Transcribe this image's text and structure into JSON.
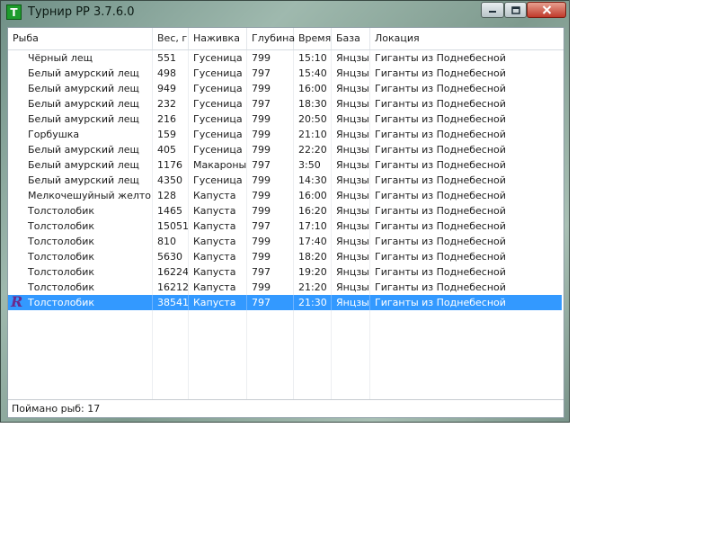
{
  "window": {
    "title": "Турнир РР 3.7.6.0",
    "app_icon_letter": "T"
  },
  "columns": [
    "Рыба",
    "Вес, г",
    "Наживка",
    "Глубина",
    "Время",
    "База",
    "Локация"
  ],
  "rows": [
    {
      "fish": "Чёрный лещ",
      "weight": "551",
      "bait": "Гусеница",
      "depth": "799",
      "time": "15:10",
      "base": "Янцзы",
      "location": "Гиганты из Поднебесной"
    },
    {
      "fish": "Белый амурский лещ",
      "weight": "498",
      "bait": "Гусеница",
      "depth": "797",
      "time": "15:40",
      "base": "Янцзы",
      "location": "Гиганты из Поднебесной"
    },
    {
      "fish": "Белый амурский лещ",
      "weight": "949",
      "bait": "Гусеница",
      "depth": "799",
      "time": "16:00",
      "base": "Янцзы",
      "location": "Гиганты из Поднебесной"
    },
    {
      "fish": "Белый амурский лещ",
      "weight": "232",
      "bait": "Гусеница",
      "depth": "797",
      "time": "18:30",
      "base": "Янцзы",
      "location": "Гиганты из Поднебесной"
    },
    {
      "fish": "Белый амурский лещ",
      "weight": "216",
      "bait": "Гусеница",
      "depth": "799",
      "time": "20:50",
      "base": "Янцзы",
      "location": "Гиганты из Поднебесной"
    },
    {
      "fish": "Горбушка",
      "weight": "159",
      "bait": "Гусеница",
      "depth": "799",
      "time": "21:10",
      "base": "Янцзы",
      "location": "Гиганты из Поднебесной"
    },
    {
      "fish": "Белый амурский лещ",
      "weight": "405",
      "bait": "Гусеница",
      "depth": "799",
      "time": "22:20",
      "base": "Янцзы",
      "location": "Гиганты из Поднебесной"
    },
    {
      "fish": "Белый амурский лещ",
      "weight": "1176",
      "bait": "Макароны",
      "depth": "797",
      "time": "3:50",
      "base": "Янцзы",
      "location": "Гиганты из Поднебесной"
    },
    {
      "fish": "Белый амурский лещ",
      "weight": "4350",
      "bait": "Гусеница",
      "depth": "799",
      "time": "14:30",
      "base": "Янцзы",
      "location": "Гиганты из Поднебесной"
    },
    {
      "fish": "Мелкочешуйный желтопёр",
      "weight": "128",
      "bait": "Капуста",
      "depth": "799",
      "time": "16:00",
      "base": "Янцзы",
      "location": "Гиганты из Поднебесной"
    },
    {
      "fish": "Толстолобик",
      "weight": "1465",
      "bait": "Капуста",
      "depth": "799",
      "time": "16:20",
      "base": "Янцзы",
      "location": "Гиганты из Поднебесной"
    },
    {
      "fish": "Толстолобик",
      "weight": "15051",
      "bait": "Капуста",
      "depth": "797",
      "time": "17:10",
      "base": "Янцзы",
      "location": "Гиганты из Поднебесной"
    },
    {
      "fish": "Толстолобик",
      "weight": "810",
      "bait": "Капуста",
      "depth": "799",
      "time": "17:40",
      "base": "Янцзы",
      "location": "Гиганты из Поднебесной"
    },
    {
      "fish": "Толстолобик",
      "weight": "5630",
      "bait": "Капуста",
      "depth": "799",
      "time": "18:20",
      "base": "Янцзы",
      "location": "Гиганты из Поднебесной"
    },
    {
      "fish": "Толстолобик",
      "weight": "16224",
      "bait": "Капуста",
      "depth": "797",
      "time": "19:20",
      "base": "Янцзы",
      "location": "Гиганты из Поднебесной"
    },
    {
      "fish": "Толстолобик",
      "weight": "16212",
      "bait": "Капуста",
      "depth": "799",
      "time": "21:20",
      "base": "Янцзы",
      "location": "Гиганты из Поднебесной"
    },
    {
      "fish": "Толстолобик",
      "weight": "38541",
      "bait": "Капуста",
      "depth": "797",
      "time": "21:30",
      "base": "Янцзы",
      "location": "Гиганты из Поднебесной",
      "selected": true,
      "marker": "R"
    }
  ],
  "status": {
    "caught_label": "Поймано рыб: 17"
  },
  "colors": {
    "selection": "#3399ff",
    "app_icon": "#1e9c2d",
    "record_marker": "#6b2a8c"
  },
  "icons": [
    "app-icon",
    "minimize-icon",
    "maximize-icon",
    "close-icon",
    "record-marker-icon"
  ]
}
